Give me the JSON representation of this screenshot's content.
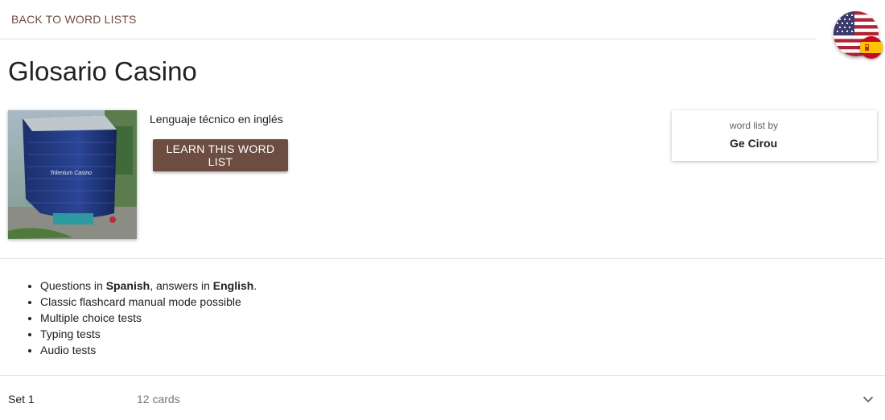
{
  "nav": {
    "back_label": "BACK TO WORD LISTS"
  },
  "language": {
    "question_flag": "us-flag-icon",
    "answer_flag": "spain-flag-icon"
  },
  "wordlist": {
    "title": "Glosario Casino",
    "description": "Lenguaje técnico en inglés",
    "learn_button": "LEARN THIS WORD LIST",
    "image_text": "Trilenium Casino"
  },
  "author": {
    "caption": "word list by",
    "name": "Ge Cirou"
  },
  "features": {
    "q_prefix": "Questions in ",
    "q_lang": "Spanish",
    "q_mid": ", answers in ",
    "a_lang": "English",
    "q_suffix": ".",
    "items": [
      "Classic flashcard manual mode possible",
      "Multiple choice tests",
      "Typing tests",
      "Audio tests"
    ]
  },
  "sets": [
    {
      "name": "Set 1",
      "count": "12 cards"
    }
  ],
  "colors": {
    "accent": "#6d4c41",
    "divider": "#e0e0e0"
  }
}
